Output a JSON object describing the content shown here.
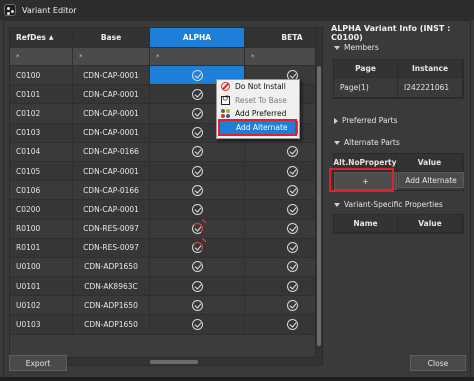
{
  "window": {
    "title": "Variant Editor"
  },
  "grid": {
    "columns": [
      {
        "key": "ref",
        "label": "RefDes",
        "sorted": "asc"
      },
      {
        "key": "base",
        "label": "Base"
      },
      {
        "key": "alpha",
        "label": "ALPHA"
      },
      {
        "key": "beta",
        "label": "BETA"
      }
    ],
    "filter_symbol": "*",
    "rows": [
      {
        "ref": "C0100",
        "base": "CDN-CAP-0001",
        "alpha": "check",
        "beta": "check",
        "alpha_selected": true
      },
      {
        "ref": "C0101",
        "base": "CDN-CAP-0001",
        "alpha": "check",
        "beta": "check"
      },
      {
        "ref": "C0102",
        "base": "CDN-CAP-0001",
        "alpha": "check",
        "beta": "check"
      },
      {
        "ref": "C0103",
        "base": "CDN-CAP-0001",
        "alpha": "check",
        "beta": "check"
      },
      {
        "ref": "C0104",
        "base": "CDN-CAP-0166",
        "alpha": "check",
        "beta": "check"
      },
      {
        "ref": "C0105",
        "base": "CDN-CAP-0001",
        "alpha": "check",
        "beta": "check"
      },
      {
        "ref": "C0106",
        "base": "CDN-CAP-0166",
        "alpha": "check",
        "beta": "check"
      },
      {
        "ref": "C0200",
        "base": "CDN-CAP-0001",
        "alpha": "check",
        "beta": "check"
      },
      {
        "ref": "R0100",
        "base": "CDN-RES-0097",
        "alpha": "bad",
        "beta": "check"
      },
      {
        "ref": "R0101",
        "base": "CDN-RES-0097",
        "alpha": "bad",
        "beta": "check"
      },
      {
        "ref": "U0100",
        "base": "CDN-ADP1650",
        "alpha": "check",
        "beta": "check"
      },
      {
        "ref": "U0101",
        "base": "CDN-AK8963C",
        "alpha": "check",
        "beta": "check"
      },
      {
        "ref": "U0102",
        "base": "CDN-ADP1650",
        "alpha": "check",
        "beta": "check"
      },
      {
        "ref": "U0103",
        "base": "CDN-ADP1650",
        "alpha": "check",
        "beta": "check"
      }
    ]
  },
  "context_menu": {
    "items": [
      {
        "label": "Do Not Install",
        "icon": "ban-icon",
        "state": "normal"
      },
      {
        "label": "Reset To Base",
        "icon": "reset-icon",
        "state": "disabled"
      },
      {
        "label": "Add Preferred",
        "icon": "preferred-icon",
        "state": "normal"
      },
      {
        "label": "Add Alternate",
        "icon": "",
        "state": "highlighted"
      }
    ]
  },
  "info_panel": {
    "title": "ALPHA Variant Info (INST : C0100)",
    "members": {
      "header": "Members",
      "columns": [
        "Page",
        "Instance"
      ],
      "rows": [
        [
          "Page(1)",
          "I242221061"
        ]
      ]
    },
    "preferred_parts": {
      "header": "Preferred Parts"
    },
    "alternate_parts": {
      "header": "Alternate Parts",
      "columns": [
        "Alt.No",
        "Property",
        "Value"
      ],
      "add_symbol": "+",
      "add_button": "Add Alternate"
    },
    "variant_props": {
      "header": "Variant-Specific Properties",
      "columns": [
        "Name",
        "Value"
      ]
    }
  },
  "footer": {
    "export_label": "Export",
    "close_label": "Close"
  },
  "colors": {
    "accent": "#1e7fd8",
    "highlight_box": "#e0202a",
    "error": "#e04848"
  }
}
